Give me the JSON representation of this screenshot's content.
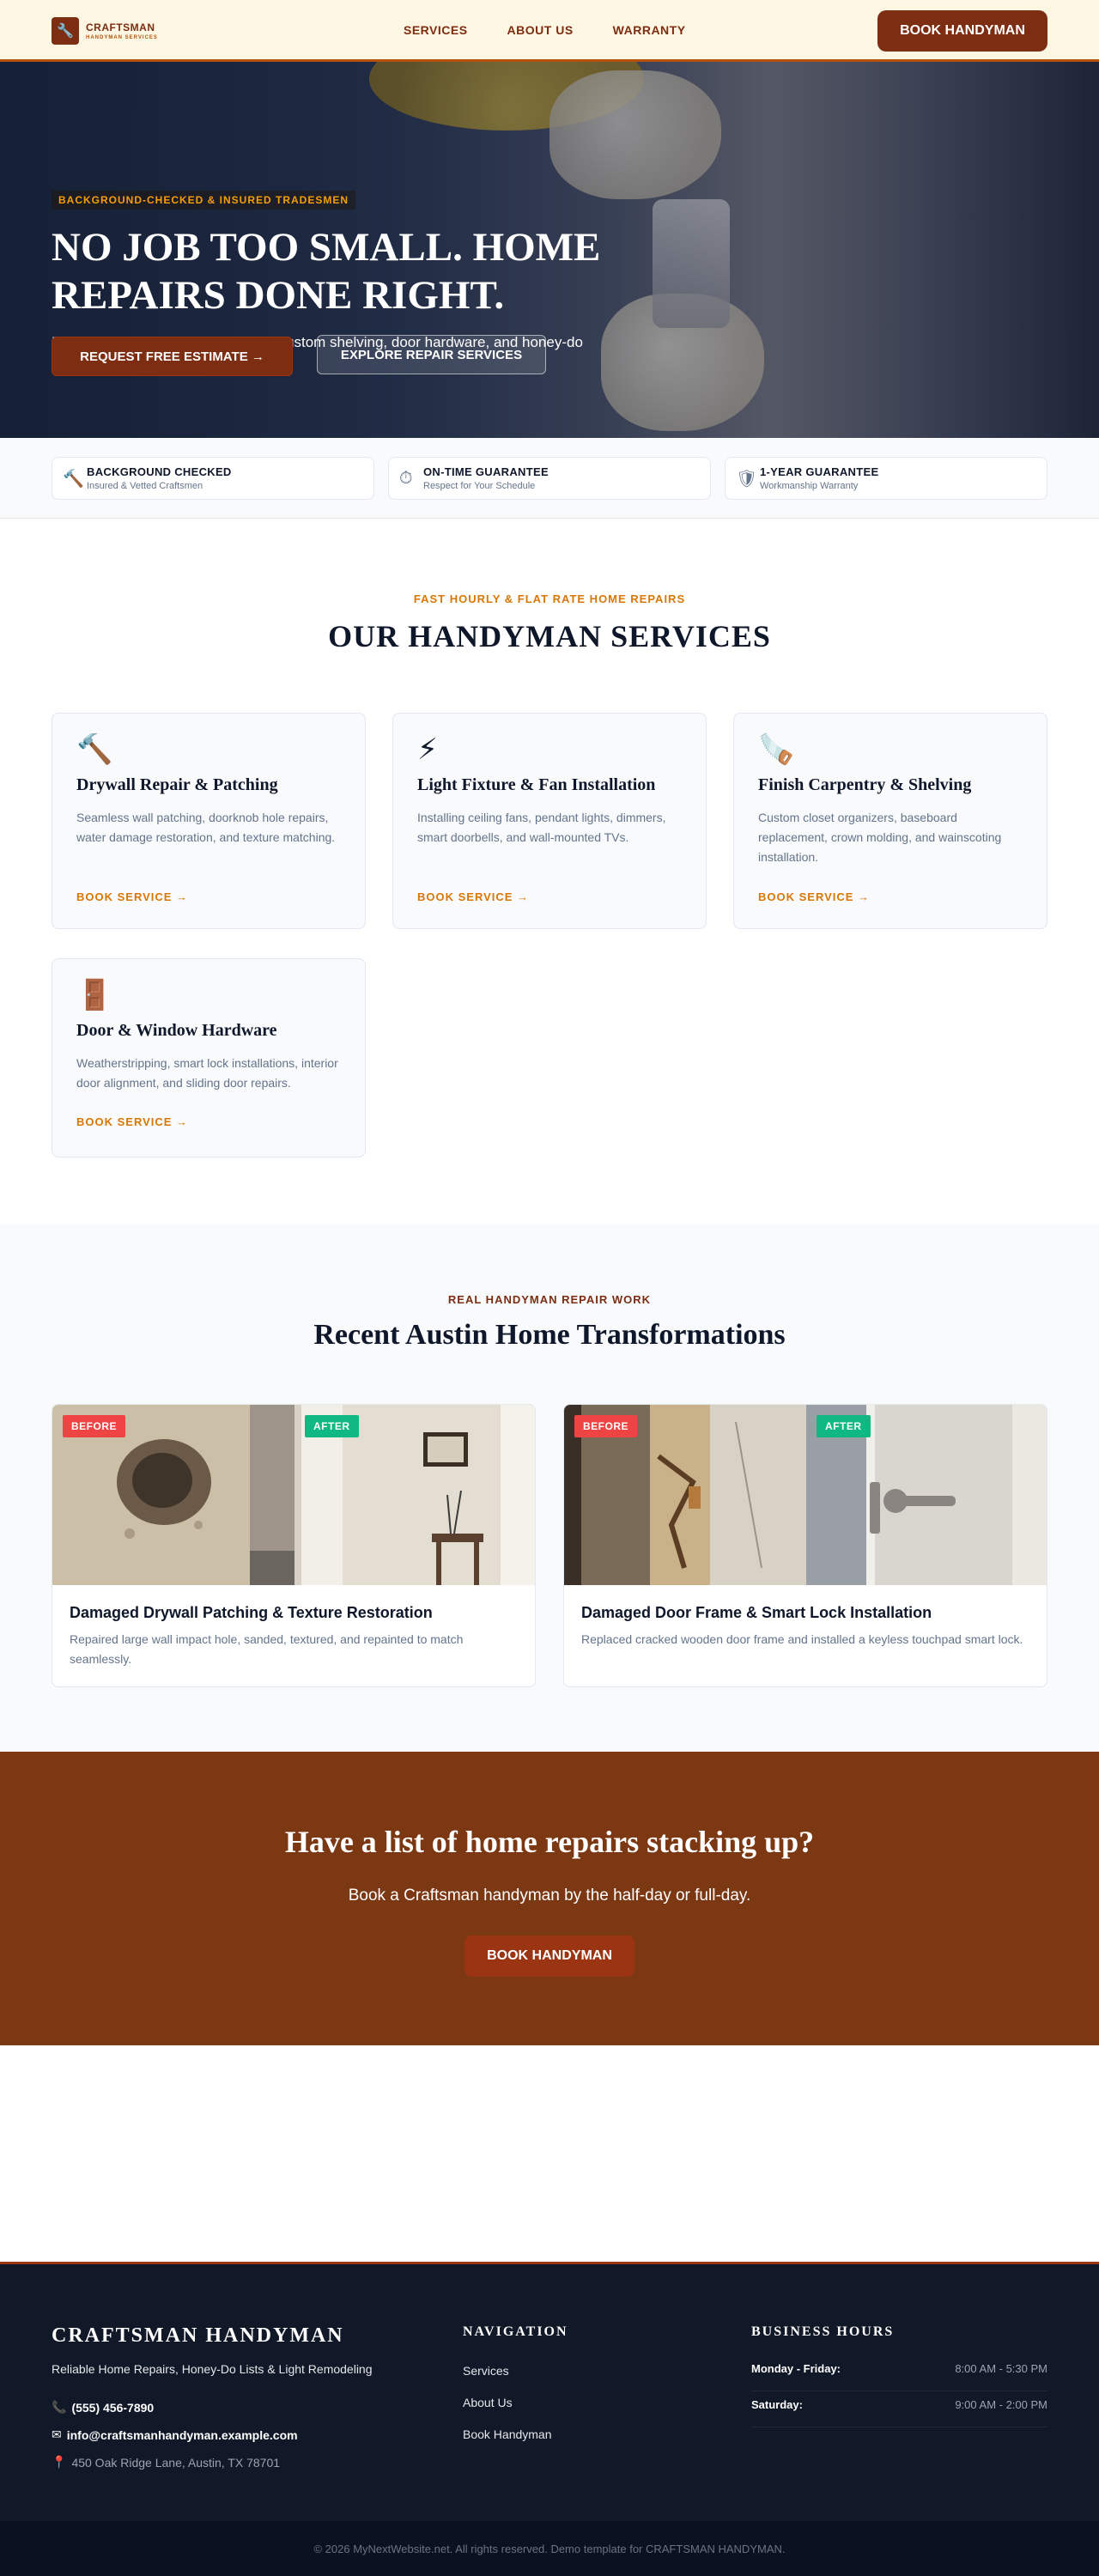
{
  "header": {
    "logo_name": "CRAFTSMAN",
    "logo_sub": "HANDYMAN SERVICES",
    "nav": [
      "SERVICES",
      "ABOUT US",
      "WARRANTY"
    ],
    "cta_label": "BOOK HANDYMAN"
  },
  "hero": {
    "eyebrow": "BACKGROUND-CHECKED & INSURED TRADESMEN",
    "title": "NO JOB TOO SMALL. HOME REPAIRS DONE RIGHT.",
    "subtitle": "Drywall repairs, ceiling fan installs, custom shelving, door hardware, and honey-do list completion.",
    "primary_button": "REQUEST FREE ESTIMATE →",
    "secondary_button": "EXPLORE REPAIR SERVICES"
  },
  "trust": [
    {
      "icon": "hammer-icon",
      "glyph": "🔨",
      "title": "BACKGROUND CHECKED",
      "desc": "Insured & Vetted Craftsmen"
    },
    {
      "icon": "stopwatch-icon",
      "glyph": "⏱",
      "title": "ON-TIME GUARANTEE",
      "desc": "Respect for Your Schedule"
    },
    {
      "icon": "shield-icon",
      "glyph": "🛡",
      "title": "1-YEAR GUARANTEE",
      "desc": "Workmanship Warranty"
    }
  ],
  "services": {
    "eyebrow": "FAST HOURLY & FLAT RATE HOME REPAIRS",
    "title": "OUR HANDYMAN SERVICES",
    "link_label": "BOOK SERVICE →",
    "items": [
      {
        "icon": "hammer-icon",
        "glyph": "🔨",
        "title": "Drywall Repair & Patching",
        "desc": "Seamless wall patching, doorknob hole repairs, water damage restoration, and texture matching."
      },
      {
        "icon": "lightning-icon",
        "glyph": "⚡",
        "title": "Light Fixture & Fan Installation",
        "desc": "Installing ceiling fans, pendant lights, dimmers, smart doorbells, and wall-mounted TVs."
      },
      {
        "icon": "saw-icon",
        "glyph": "🪚",
        "title": "Finish Carpentry & Shelving",
        "desc": "Custom closet organizers, baseboard replacement, crown molding, and wainscoting installation."
      },
      {
        "icon": "door-icon",
        "glyph": "🚪",
        "title": "Door & Window Hardware",
        "desc": "Weatherstripping, smart lock installations, interior door alignment, and sliding door repairs."
      }
    ]
  },
  "projects": {
    "eyebrow": "REAL HANDYMAN REPAIR WORK",
    "title": "Recent Austin Home Transformations",
    "before_label": "BEFORE",
    "after_label": "AFTER",
    "items": [
      {
        "title": "Damaged Drywall Patching & Texture Restoration",
        "desc": "Repaired large wall impact hole, sanded, textured, and repainted to match seamlessly."
      },
      {
        "title": "Damaged Door Frame & Smart Lock Installation",
        "desc": "Replaced cracked wooden door frame and installed a keyless touchpad smart lock."
      }
    ]
  },
  "cta": {
    "title": "Have a list of home repairs stacking up?",
    "subtitle": "Book a Craftsman handyman by the half-day or full-day.",
    "button": "BOOK HANDYMAN"
  },
  "footer": {
    "brand": "CRAFTSMAN HANDYMAN",
    "tagline": "Reliable Home Repairs, Honey-Do Lists & Light Remodeling",
    "phone": "(555) 456-7890",
    "email": "info@craftsmanhandyman.example.com",
    "address": "450 Oak Ridge Lane, Austin, TX 78701",
    "nav_heading": "NAVIGATION",
    "nav": [
      "Services",
      "About Us",
      "Book Handyman"
    ],
    "hours_heading": "BUSINESS HOURS",
    "hours": [
      {
        "day": "Monday - Friday:",
        "time": "8:00 AM - 5:30 PM"
      },
      {
        "day": "Saturday:",
        "time": "9:00 AM - 2:00 PM"
      }
    ],
    "copyright": "© 2026 MyNextWebsite.net. All rights reserved. Demo template for CRAFTSMAN HANDYMAN."
  },
  "colors": {
    "brand": "#7c2d12",
    "accent": "#d97706",
    "before_badge": "#ef4444",
    "after_badge": "#10b981"
  }
}
